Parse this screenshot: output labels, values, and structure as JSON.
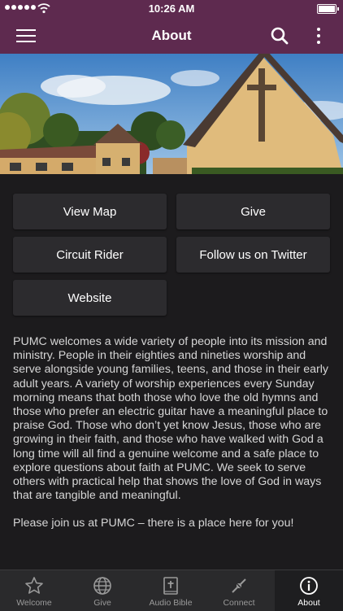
{
  "status": {
    "time": "10:26 AM"
  },
  "nav": {
    "title": "About"
  },
  "buttons": {
    "view_map": "View Map",
    "give": "Give",
    "circuit_rider": "Circuit Rider",
    "twitter": "Follow us on Twitter",
    "website": "Website"
  },
  "description": {
    "paragraph1": "PUMC welcomes a wide variety of people into its mission and ministry. People in their eighties and nineties worship and serve alongside young families, teens, and those in their early adult years. A variety of worship experiences every Sunday morning means that both those who love the old hymns and those who prefer an electric guitar have a meaningful place to praise God. Those who don’t yet know Jesus, those who are growing in their faith, and those who have walked with God a long time will all find a genuine welcome and a safe place to explore questions about faith at PUMC. We seek to serve others with practical help that shows the love of God in ways that are tangible and meaningful.",
    "paragraph2": "Please join us at PUMC – there is a place here for you!"
  },
  "tabs": [
    {
      "label": "Welcome",
      "icon": "star-icon"
    },
    {
      "label": "Give",
      "icon": "globe-icon"
    },
    {
      "label": "Audio Bible",
      "icon": "bible-icon"
    },
    {
      "label": "Connect",
      "icon": "connect-icon"
    },
    {
      "label": "About",
      "icon": "info-icon",
      "active": true
    }
  ],
  "colors": {
    "brand": "#5e2a4f",
    "background": "#1c1b1d",
    "button": "#2c2b2e"
  }
}
